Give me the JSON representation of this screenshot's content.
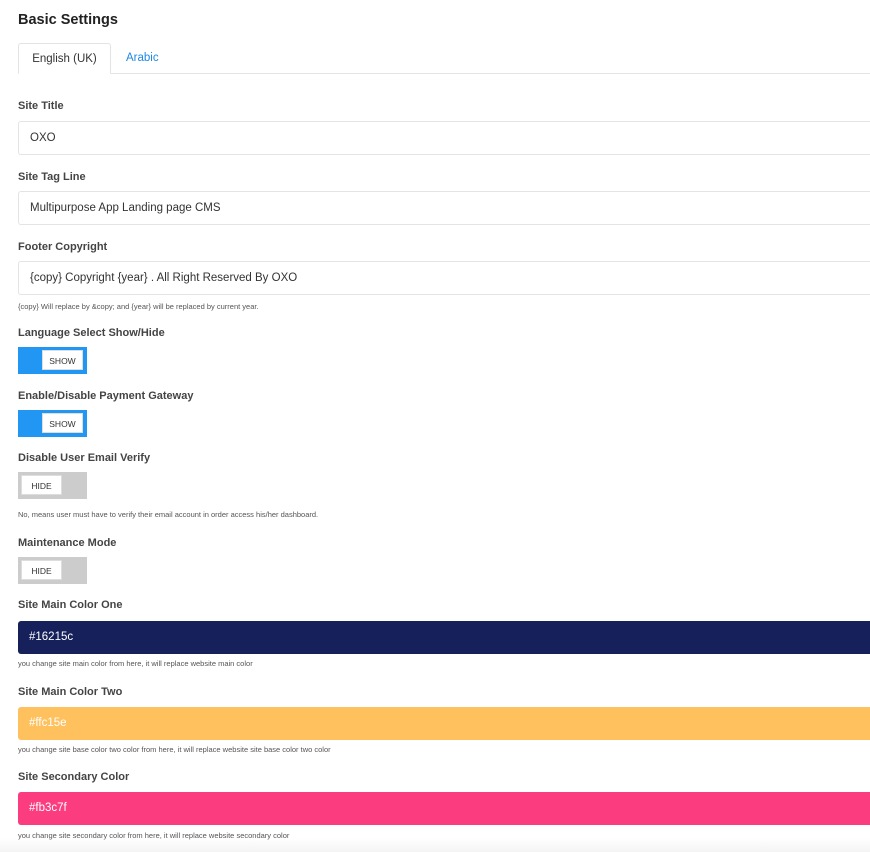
{
  "page": {
    "title": "Basic Settings"
  },
  "tabs": [
    {
      "label": "English (UK)",
      "active": true
    },
    {
      "label": "Arabic",
      "active": false
    }
  ],
  "fields": {
    "site_title": {
      "label": "Site Title",
      "value": "OXO"
    },
    "site_tag_line": {
      "label": "Site Tag Line",
      "value": "Multipurpose App Landing page CMS"
    },
    "footer_copyright": {
      "label": "Footer Copyright",
      "value": "{copy} Copyright {year} . All Right Reserved By OXO",
      "help": "{copy} Will replace by &copy; and {year} will be replaced by current year."
    }
  },
  "toggles": {
    "language_select": {
      "label": "Language Select Show/Hide",
      "state": "SHOW",
      "on": true
    },
    "payment_gateway": {
      "label": "Enable/Disable Payment Gateway",
      "state": "SHOW",
      "on": true
    },
    "email_verify": {
      "label": "Disable User Email Verify",
      "state": "HIDE",
      "on": false,
      "help": "No, means user must have to verify their email account in order access his/her dashboard."
    },
    "maintenance": {
      "label": "Maintenance Mode",
      "state": "HIDE",
      "on": false
    }
  },
  "colors": {
    "main_one": {
      "label": "Site Main Color One",
      "value": "#16215c",
      "help": "you change site main color from here, it will replace website main color"
    },
    "main_two": {
      "label": "Site Main Color Two",
      "value": "#ffc15e",
      "help": "you change site base color two color from here, it will replace website site base color two color"
    },
    "secondary": {
      "label": "Site Secondary Color",
      "value": "#fb3c7f",
      "help": "you change site secondary color from here, it will replace website secondary color"
    }
  },
  "theme": {
    "toggle_on": "#2196f3",
    "toggle_off": "#cccccc",
    "link": "#1e88e5"
  }
}
